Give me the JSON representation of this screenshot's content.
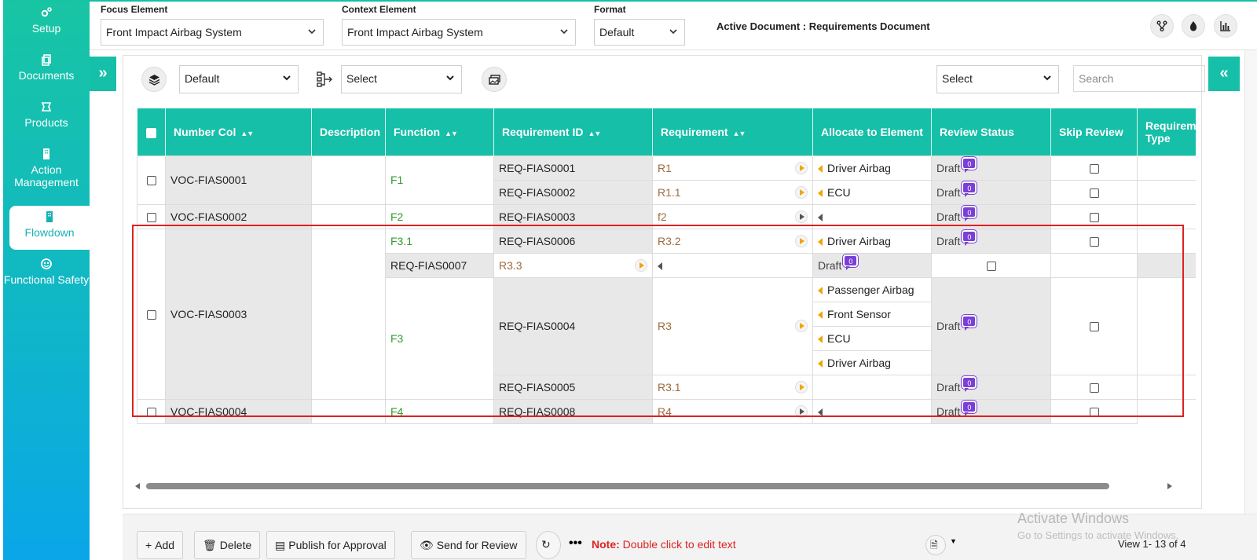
{
  "sidebar": {
    "items": [
      {
        "label": "Setup",
        "icon": "gears-icon"
      },
      {
        "label": "Documents",
        "icon": "copy-icon"
      },
      {
        "label": "Products",
        "icon": "box-icon"
      },
      {
        "label": "Action Management",
        "icon": "building-icon"
      },
      {
        "label": "Flowdown",
        "icon": "building-icon"
      },
      {
        "label": "Functional Safety",
        "icon": "dashboard-icon"
      }
    ],
    "active": "Flowdown"
  },
  "header": {
    "focus_label": "Focus Element",
    "focus_value": "Front Impact Airbag System",
    "context_label": "Context Element",
    "context_value": "Front Impact Airbag System",
    "format_label": "Format",
    "format_value": "Default",
    "active_doc": "Active Document : Requirements Document"
  },
  "toolbar": {
    "view_select": "Default",
    "hierarchy_select": "Select",
    "right_select": "Select",
    "search_placeholder": "Search"
  },
  "columns": [
    "Number Col",
    "Description",
    "Function",
    "Requirement ID",
    "Requirement",
    "Allocate to Element",
    "Review Status",
    "Skip Review",
    "Requirement Type"
  ],
  "rows": {
    "voc1": "VOC-FIAS0001",
    "voc2": "VOC-FIAS0002",
    "voc3": "VOC-FIAS0003",
    "voc4": "VOC-FIAS0004",
    "f1": "F1",
    "f2": "F2",
    "f31": "F3.1",
    "f3": "F3",
    "f4": "F4",
    "id1": "REQ-FIAS0001",
    "id2": "REQ-FIAS0002",
    "id3": "REQ-FIAS0003",
    "id6": "REQ-FIAS0006",
    "id7": "REQ-FIAS0007",
    "id4": "REQ-FIAS0004",
    "id5": "REQ-FIAS0005",
    "id8": "REQ-FIAS0008",
    "r1": "R1",
    "r11": "R1.1",
    "f2r": "f2",
    "r32": "R3.2",
    "r33": "R3.3",
    "r3": "R3",
    "r31": "R3.1",
    "r4": "R4",
    "el_driver": "Driver Airbag",
    "el_ecu": "ECU",
    "el_passenger": "Passenger Airbag",
    "el_front": "Front Sensor",
    "draft": "Draft",
    "comment_count": "0"
  },
  "footer": {
    "add": "Add",
    "delete": "Delete",
    "publish": "Publish for Approval",
    "send": "Send for Review",
    "note_label": "Note:",
    "note_text": "Double click to edit text",
    "view_count": "View 1- 13 of 4",
    "watermark_title": "Activate Windows",
    "watermark_sub": "Go to Settings to activate Windows."
  },
  "colors": {
    "accent": "#16bfa8",
    "sidebar_bottom": "#0aa6e8",
    "function_text": "#2f9e2f",
    "requirement_text": "#a06a3d",
    "note": "#dd2222",
    "badge": "#7a3fd4"
  }
}
